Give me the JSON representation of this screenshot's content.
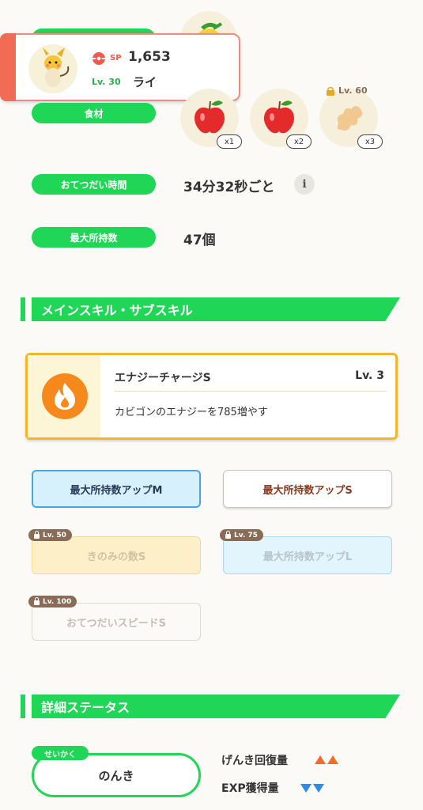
{
  "pokemon": {
    "sp_label": "SP",
    "sp_value": "1,653",
    "level": "Lv. 30",
    "name": "ライ"
  },
  "ingredients_label": "食材",
  "ingredients": [
    {
      "name": "apple",
      "qty": "x1"
    },
    {
      "name": "apple",
      "qty": "x2"
    },
    {
      "name": "ginger",
      "qty": "x3",
      "unlock": "Lv. 60"
    }
  ],
  "help_time": {
    "label": "おてつだい時間",
    "value": "34分32秒ごと"
  },
  "max_carry": {
    "label": "最大所持数",
    "value": "47個"
  },
  "skills_header": "メインスキル・サブスキル",
  "main_skill": {
    "name": "エナジーチャージS",
    "level": "Lv. 3",
    "description": "カビゴンのエナジーを785増やす"
  },
  "subskills": [
    {
      "label": "最大所持数アップM"
    },
    {
      "label": "最大所持数アップS"
    },
    {
      "label": "きのみの数S",
      "unlock": "Lv. 50"
    },
    {
      "label": "最大所持数アップL",
      "unlock": "Lv. 75"
    },
    {
      "label": "おてつだいスピードS",
      "unlock": "Lv. 100"
    }
  ],
  "detail_header": "詳細ステータス",
  "nature": {
    "tag": "せいかく",
    "value": "のんき",
    "up_label": "げんき回復量",
    "down_label": "EXP獲得量"
  },
  "colors": {
    "accent_green": "#1fd657",
    "up": "#f26b2a",
    "down": "#2b8de8"
  }
}
